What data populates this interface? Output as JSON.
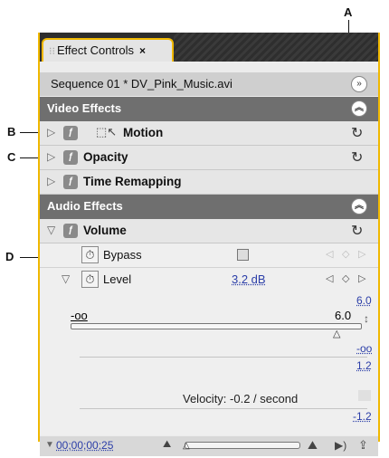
{
  "callouts": {
    "a": "A",
    "b": "B",
    "c": "C",
    "d": "D"
  },
  "panel": {
    "tab_label": "Effect Controls",
    "close_glyph": "×",
    "sequence": "Sequence 01 * DV_Pink_Music.avi",
    "video_effects_header": "Video Effects",
    "effects": {
      "motion": "Motion",
      "opacity": "Opacity",
      "time_remapping": "Time Remapping"
    },
    "audio_effects_header": "Audio Effects",
    "volume": {
      "name": "Volume",
      "bypass_label": "Bypass",
      "level_label": "Level",
      "level_value": "3.2 dB",
      "slider_min": "-oo",
      "slider_max": "6.0",
      "scale_top": "6.0",
      "scale_neg_inf": "-oo",
      "scale_vel_top": "1.2",
      "scale_vel_bottom": "-1.2",
      "velocity": "Velocity: -0.2 / second"
    },
    "timecode": "00;00;00;25"
  },
  "colors": {
    "accent": "#f0b800",
    "header_bg": "#6f6f6f",
    "value_blue": "#2b3ea8"
  }
}
